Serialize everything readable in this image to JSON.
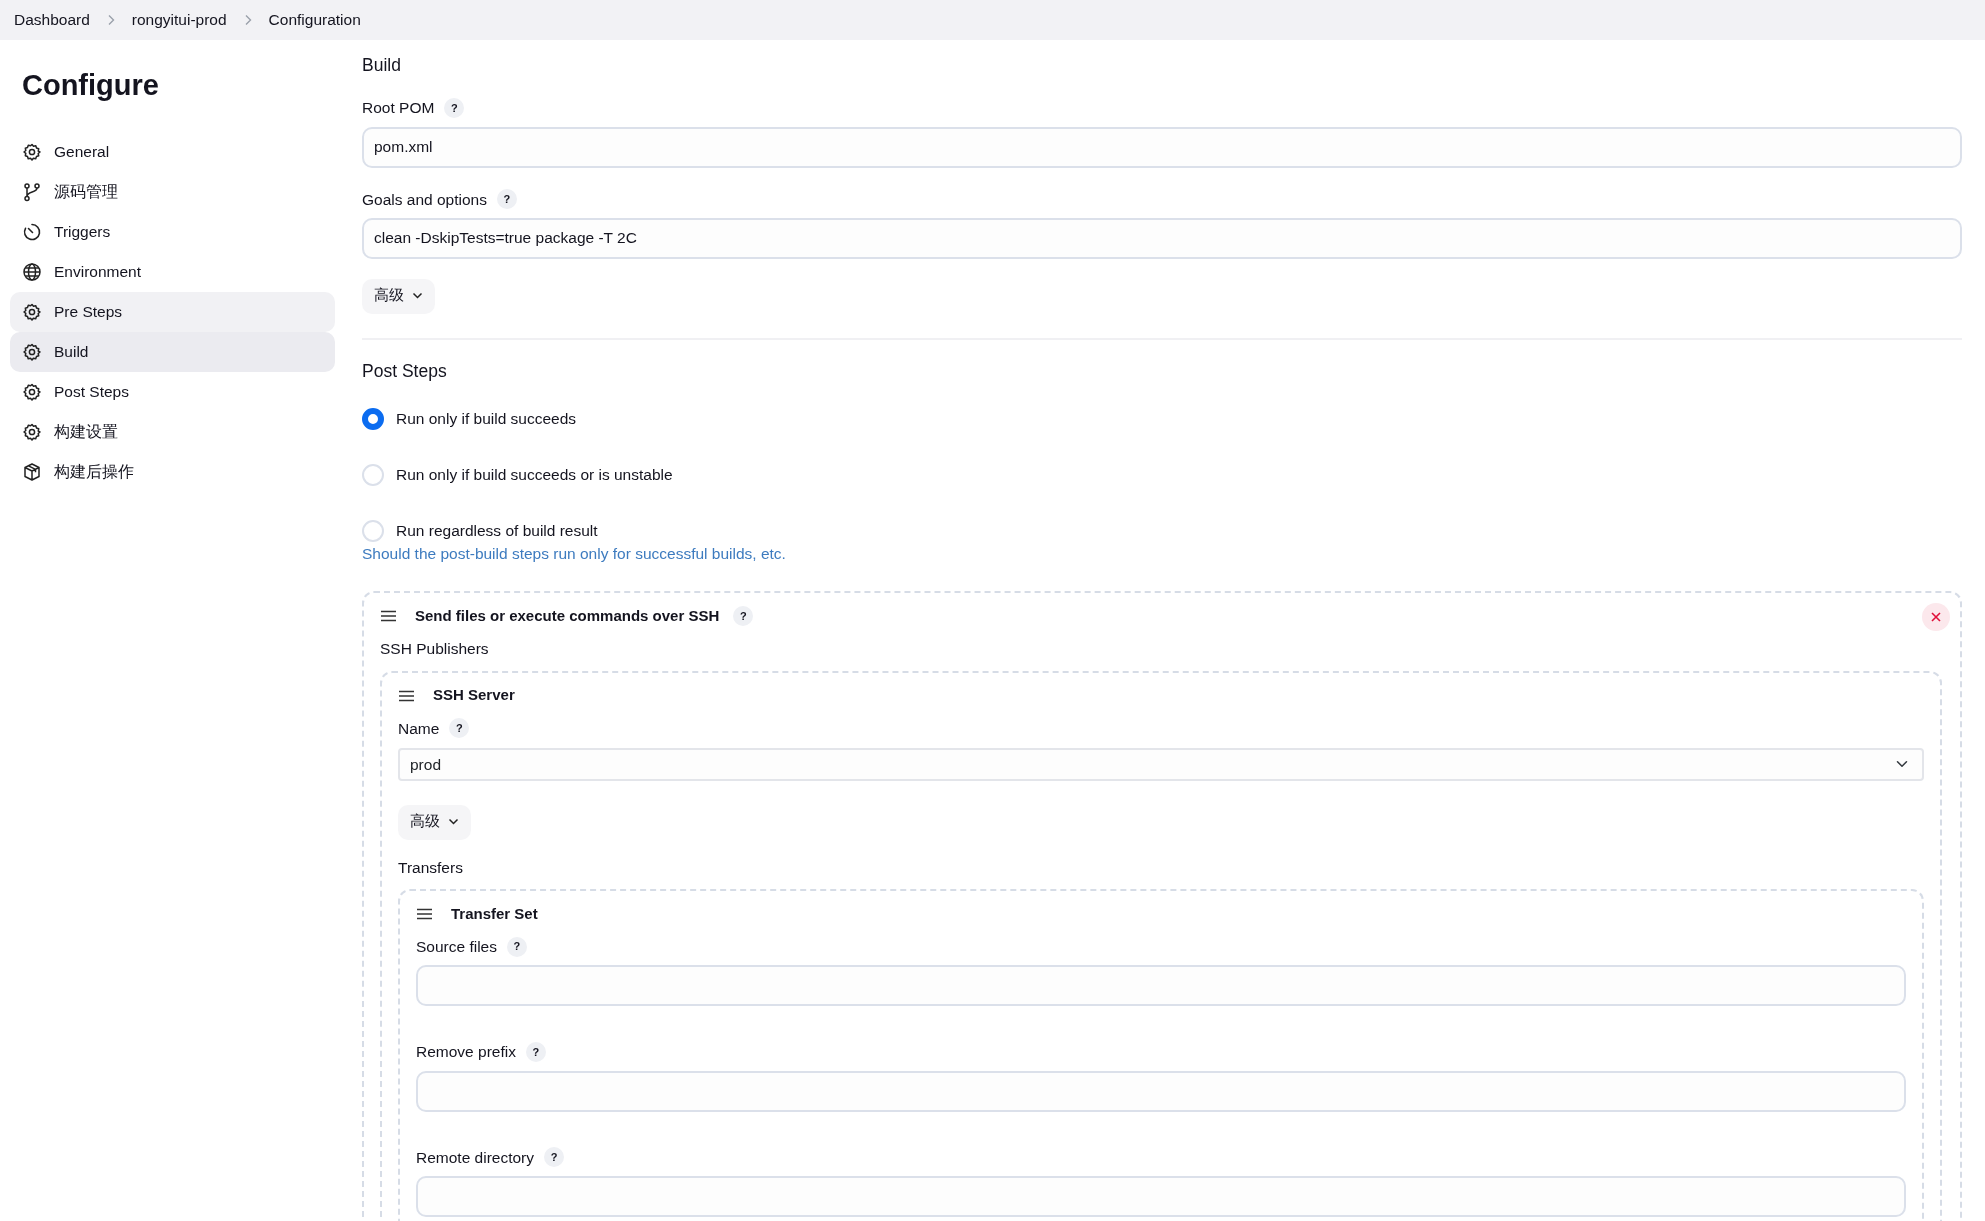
{
  "breadcrumbs": [
    {
      "label": "Dashboard"
    },
    {
      "label": "rongyitui-prod"
    },
    {
      "label": "Configuration"
    }
  ],
  "sidebar": {
    "title": "Configure",
    "items": [
      {
        "label": "General",
        "kind": "gear",
        "selected": false,
        "hovered": false
      },
      {
        "label": "源码管理",
        "kind": "branch",
        "selected": false,
        "hovered": false
      },
      {
        "label": "Triggers",
        "kind": "timer",
        "selected": false,
        "hovered": false
      },
      {
        "label": "Environment",
        "kind": "globe",
        "selected": false,
        "hovered": false
      },
      {
        "label": "Pre Steps",
        "kind": "gear",
        "selected": false,
        "hovered": true
      },
      {
        "label": "Build",
        "kind": "gear",
        "selected": true,
        "hovered": false
      },
      {
        "label": "Post Steps",
        "kind": "gear",
        "selected": false,
        "hovered": false
      },
      {
        "label": "构建设置",
        "kind": "gear",
        "selected": false,
        "hovered": false
      },
      {
        "label": "构建后操作",
        "kind": "box",
        "selected": false,
        "hovered": false
      }
    ]
  },
  "build": {
    "title": "Build",
    "fields": [
      {
        "label": "Root POM",
        "help": "?",
        "value": "pom.xml"
      },
      {
        "label": "Goals and options",
        "help": "?",
        "value": "clean -DskipTests=true package -T 2C"
      }
    ],
    "advanced_button": "高级"
  },
  "post_steps": {
    "title": "Post Steps",
    "options": [
      {
        "label": "Run only if build succeeds",
        "selected": true
      },
      {
        "label": "Run only if build succeeds or is unstable",
        "selected": false
      },
      {
        "label": "Run regardless of build result",
        "selected": false
      }
    ],
    "hint": "Should the post-build steps run only for successful builds, etc."
  },
  "ssh_step": {
    "title": "Send files or execute commands over SSH",
    "help": "?",
    "publishers_label": "SSH Publishers",
    "server": {
      "title": "SSH Server",
      "name_label": "Name",
      "name_help": "?",
      "name_value": "prod",
      "advanced_button": "高级",
      "transfers_label": "Transfers",
      "transfer_set": {
        "title": "Transfer Set",
        "fields": [
          {
            "label": "Source files",
            "help": "?"
          },
          {
            "label": "Remove prefix",
            "help": "?"
          },
          {
            "label": "Remote directory",
            "help": "?"
          }
        ]
      }
    }
  }
}
